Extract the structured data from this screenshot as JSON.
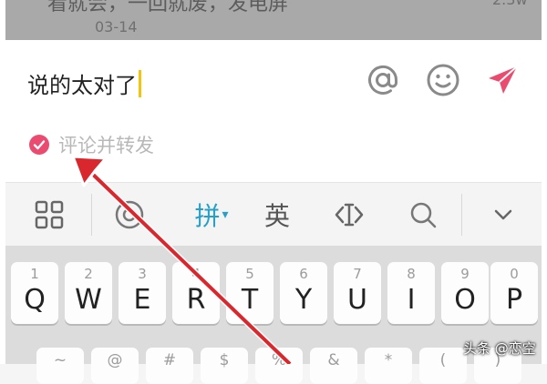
{
  "feed": {
    "post_text": "看就会，一回就废，发电屏",
    "date": "03-14",
    "count": "2.3w"
  },
  "comment": {
    "input_value": "说的太对了",
    "repost_label": "评论并转发",
    "repost_checked": true,
    "accent_color": "#ea4b6f",
    "icons": [
      "at-icon",
      "emoji-icon",
      "send-icon"
    ]
  },
  "ime_toolbar": {
    "pinyin_label": "拼",
    "english_label": "英",
    "items": [
      "grid-icon",
      "emoji-face-icon",
      "pinyin",
      "english",
      "cursor-icon",
      "search-icon",
      "collapse-chevron-icon"
    ],
    "accent_color": "#27a0c8"
  },
  "keyboard": {
    "row1": [
      {
        "num": "1",
        "letter": "Q"
      },
      {
        "num": "2",
        "letter": "W"
      },
      {
        "num": "3",
        "letter": "E"
      },
      {
        "num": "4",
        "letter": "R"
      },
      {
        "num": "5",
        "letter": "T"
      },
      {
        "num": "6",
        "letter": "Y"
      },
      {
        "num": "7",
        "letter": "U"
      },
      {
        "num": "8",
        "letter": "I"
      },
      {
        "num": "9",
        "letter": "O"
      },
      {
        "num": "0",
        "letter": "P"
      }
    ],
    "row2_symbols": [
      "~",
      "@",
      "#",
      "$",
      "%",
      "&",
      "*",
      "(",
      ")"
    ]
  },
  "watermark": "头条 @恋空"
}
